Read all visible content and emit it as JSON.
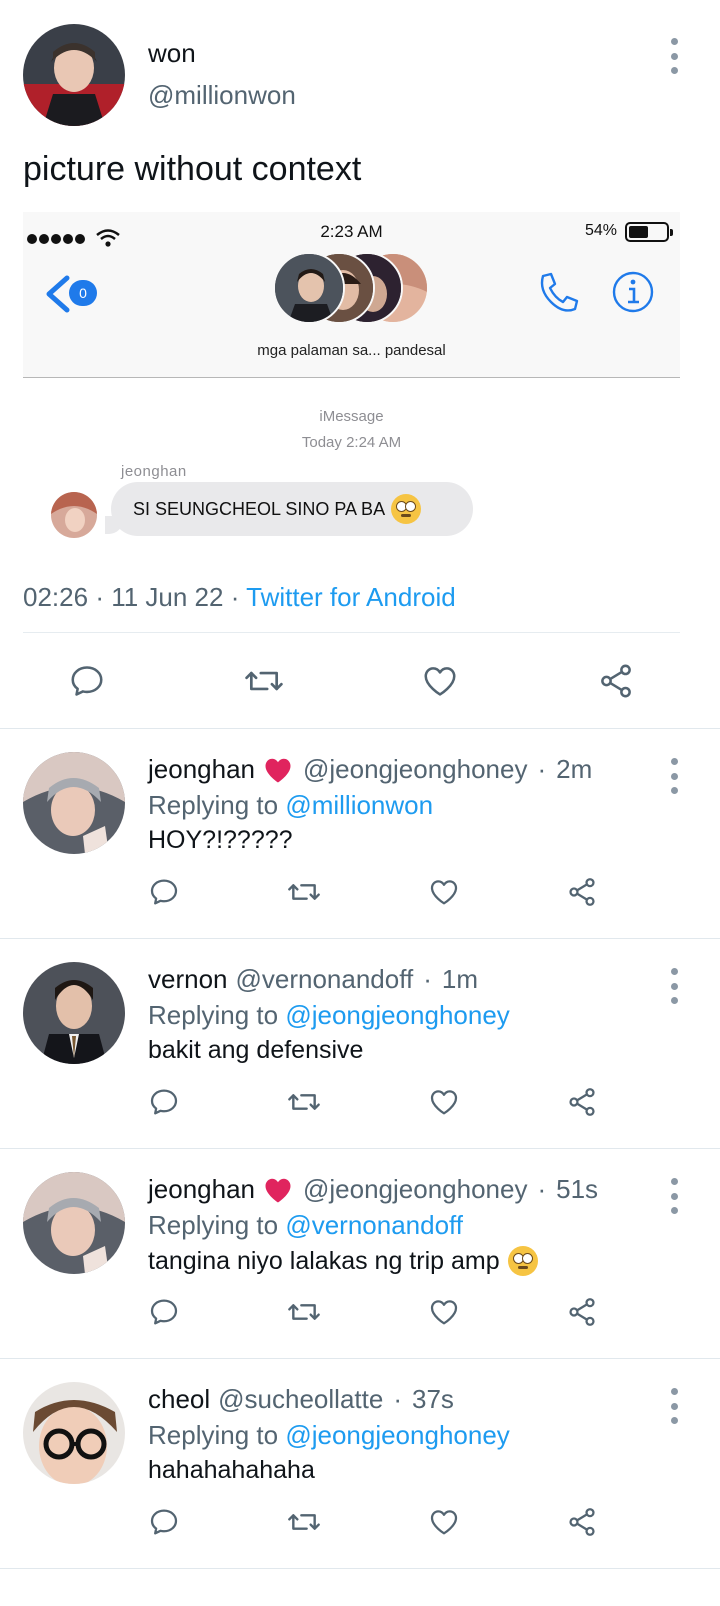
{
  "main_tweet": {
    "name": "won",
    "handle": "@millionwon",
    "text": "picture without context",
    "time": "02:26",
    "date": "11 Jun 22",
    "source": "Twitter for Android",
    "menu_icon": "more-vertical-icon"
  },
  "embedded_screenshot": {
    "status_time": "2:23 AM",
    "battery": "54%",
    "back_badge": "0",
    "group_name": "mga palaman sa... pandesal",
    "service_label": "iMessage",
    "timestamp": "Today 2:24 AM",
    "sender": "jeonghan",
    "message": "SI SEUNGCHEOL SINO PA BA"
  },
  "actions": {
    "reply_icon": "comment-icon",
    "retweet_icon": "retweet-icon",
    "like_icon": "heart-outline-icon",
    "share_icon": "share-icon"
  },
  "replies": [
    {
      "name": "jeonghan",
      "has_heart": true,
      "handle": "@jeongjeonghoney",
      "sep": "·",
      "time": "2m",
      "replying_prefix": "Replying to",
      "replying_to": "@millionwon",
      "text": "HOY?!?????",
      "has_emoji": false
    },
    {
      "name": "vernon",
      "has_heart": false,
      "handle": "@vernonandoff",
      "sep": "·",
      "time": "1m",
      "replying_prefix": "Replying to",
      "replying_to": "@jeongjeonghoney",
      "text": "bakit ang defensive",
      "has_emoji": false
    },
    {
      "name": "jeonghan",
      "has_heart": true,
      "handle": "@jeongjeonghoney",
      "sep": "·",
      "time": "51s",
      "replying_prefix": "Replying to",
      "replying_to": "@vernonandoff",
      "text": "tangina niyo lalakas ng trip amp",
      "has_emoji": true
    },
    {
      "name": "cheol",
      "has_heart": false,
      "handle": "@sucheollatte",
      "sep": "·",
      "time": "37s",
      "replying_prefix": "Replying to",
      "replying_to": "@jeongjeonghoney",
      "text": "hahahahahaha",
      "has_emoji": false
    }
  ],
  "colors": {
    "link": "#1d9bf0",
    "secondary_text": "#536471",
    "heart": "#e0245e",
    "ios_blue": "#1f7aea"
  }
}
